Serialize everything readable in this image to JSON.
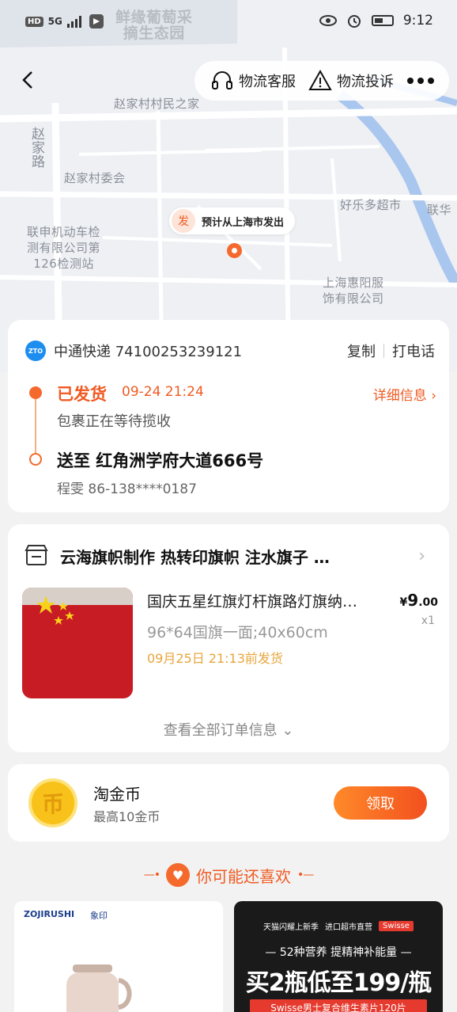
{
  "status_bar": {
    "hd": "HD",
    "network": "5G",
    "time": "9:12"
  },
  "map": {
    "labels": {
      "park": "鲜缘葡萄采\n摘生态园",
      "villager_home": "赵家村村民之家",
      "road": "赵家路",
      "committee": "赵家村委会",
      "supermarket": "好乐多超市",
      "lianhua": "联华",
      "test_station": "联申机动车检\n测有限公司第\n126检测站",
      "clothing": "上海惠阳服\n饰有限公司"
    },
    "marker": {
      "badge": "发",
      "text": "预计从上海市发出"
    }
  },
  "top_nav": {
    "service_label": "物流客服",
    "complaint_label": "物流投诉"
  },
  "logistics": {
    "courier": "中通快递 74100253239121",
    "copy_label": "复制",
    "call_label": "打电话",
    "status": "已发货",
    "status_time": "09-24 21:24",
    "detail_label": "详细信息",
    "status_desc": "包裹正在等待揽收",
    "deliver_to": "送至 红角洲学府大道666号",
    "receiver": "程雯 86-138****0187"
  },
  "order": {
    "shop_name": "云海旗帜制作  热转印旗帜 注水旗子 …",
    "product_title": "国庆五星红旗灯杆旗路灯旗纳…",
    "product_spec": "96*64国旗一面;40x60cm",
    "deadline": "09月25日 21:13前发货",
    "price_symbol": "¥",
    "price_int": "9",
    "price_dec": ".00",
    "quantity": "x1",
    "view_all": "查看全部订单信息"
  },
  "coin": {
    "title": "淘金币",
    "subtitle": "最高10金币",
    "claim_label": "领取"
  },
  "recommend": {
    "heading": "你可能还喜欢",
    "left_brand": "ZOJIRUSHI",
    "left_brand_cn": "象印",
    "ad_top_left": "天猫闪耀上新季",
    "ad_top_mid": "进口超市直营",
    "ad_top_tag": "Swisse",
    "ad_line1": "— 52种营养 提精神补能量 —",
    "ad_line2": "买2瓶低至199/瓶",
    "ad_line3": "Swisse男士复合维生素片120片"
  },
  "colors": {
    "accent": "#f05a22",
    "deadline": "#e8a63c"
  }
}
